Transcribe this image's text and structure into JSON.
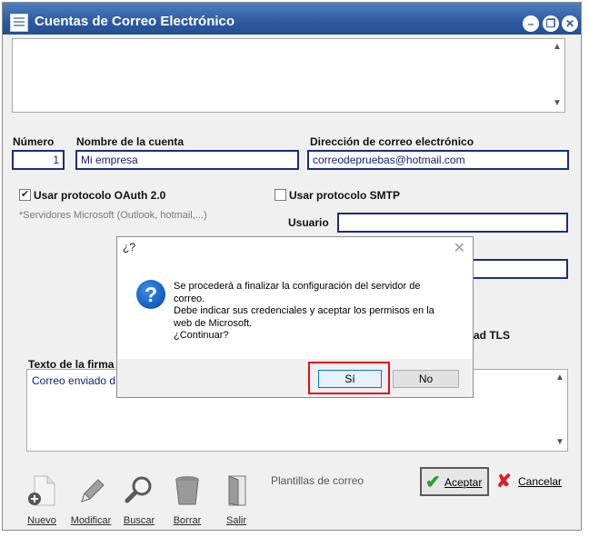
{
  "window": {
    "title": "Cuentas de Correo Electrónico",
    "controls": [
      "minimize",
      "restore",
      "close"
    ]
  },
  "form": {
    "numero_label": "Número",
    "numero_value": "1",
    "nombre_label": "Nombre de la cuenta",
    "nombre_value": "Mi empresa",
    "direccion_label": "Dirección de correo electrónico",
    "direccion_value": "correodepruebas@hotmail.com",
    "oauth_label": "Usar protocolo OAuth 2.0",
    "oauth_checked": true,
    "oauth_note": "*Servidores Microsoft (Outlook, hotmail,...)",
    "smtp_label": "Usar protocolo SMTP",
    "smtp_checked": false,
    "usuario_label": "Usuario",
    "usuario_value": "",
    "tls_label_partial": "ad TLS",
    "firma_label": "Texto de la firma",
    "firma_value": "Correo enviado d"
  },
  "dialog": {
    "title": "¿?",
    "lines": [
      "Se procederá a finalizar la configuración del servidor de",
      "correo.",
      "Debe indicar sus credenciales y aceptar los permisos en la",
      "web de Microsoft.",
      "¿Continuar?"
    ],
    "yes_label": "Sí",
    "no_label": "No",
    "highlight_color": "#e0101a"
  },
  "toolbar": {
    "nuevo": "Nuevo",
    "modificar": "Modificar",
    "buscar": "Buscar",
    "borrar": "Borrar",
    "salir": "Salir",
    "plantillas": "Plantillas de correo",
    "aceptar": "Aceptar",
    "cancelar": "Cancelar"
  },
  "colors": {
    "title_bar": "#2d5aa0",
    "field_border": "#1c2e7a",
    "field_text": "#0d1f7a"
  }
}
